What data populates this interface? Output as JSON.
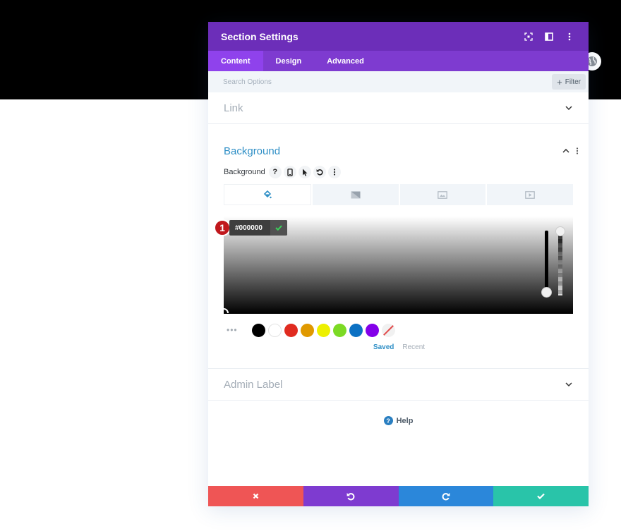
{
  "modal": {
    "title": "Section Settings",
    "header_icons": [
      "fullscreen-icon",
      "split-view-icon",
      "more-options-icon"
    ],
    "tabs": [
      {
        "label": "Content",
        "active": true
      },
      {
        "label": "Design",
        "active": false
      },
      {
        "label": "Advanced",
        "active": false
      }
    ],
    "search": {
      "placeholder": "Search Options",
      "value": ""
    },
    "filter_label": "Filter",
    "filter_icon": "+"
  },
  "sections": {
    "link": {
      "title": "Link",
      "expanded": false
    },
    "background": {
      "title": "Background",
      "expanded": true,
      "option_label": "Background",
      "option_icons": [
        "help-icon",
        "mobile-icon",
        "hover-cursor-icon",
        "reset-icon",
        "more-icon"
      ],
      "help_glyph": "?",
      "bg_type_tabs": [
        "color",
        "gradient",
        "image",
        "video"
      ],
      "active_type": "color",
      "color_picker": {
        "hex_value": "#000000",
        "badge_number": "1",
        "swatches": [
          "#000000",
          "#ffffff",
          "#e02b20",
          "#e09900",
          "#edf000",
          "#7cda24",
          "#0c71c3",
          "#8300e9"
        ],
        "swatch_tabs": {
          "saved": "Saved",
          "recent": "Recent"
        },
        "active_swatch_tab": "saved"
      }
    },
    "admin_label": {
      "title": "Admin Label",
      "expanded": false
    }
  },
  "help": {
    "label": "Help",
    "glyph": "?"
  },
  "footer": {
    "buttons": [
      {
        "name": "discard",
        "icon": "close-icon",
        "color": "#ef5555"
      },
      {
        "name": "undo",
        "icon": "undo-icon",
        "color": "#7e3bd0"
      },
      {
        "name": "redo",
        "icon": "redo-icon",
        "color": "#2b87da"
      },
      {
        "name": "save",
        "icon": "check-icon",
        "color": "#29c4a9"
      }
    ]
  },
  "colors": {
    "header": "#6c2eb9",
    "tabs": "#7e3bd0",
    "active_tab": "#8f42ec",
    "accent_blue": "#2f8fc6"
  }
}
